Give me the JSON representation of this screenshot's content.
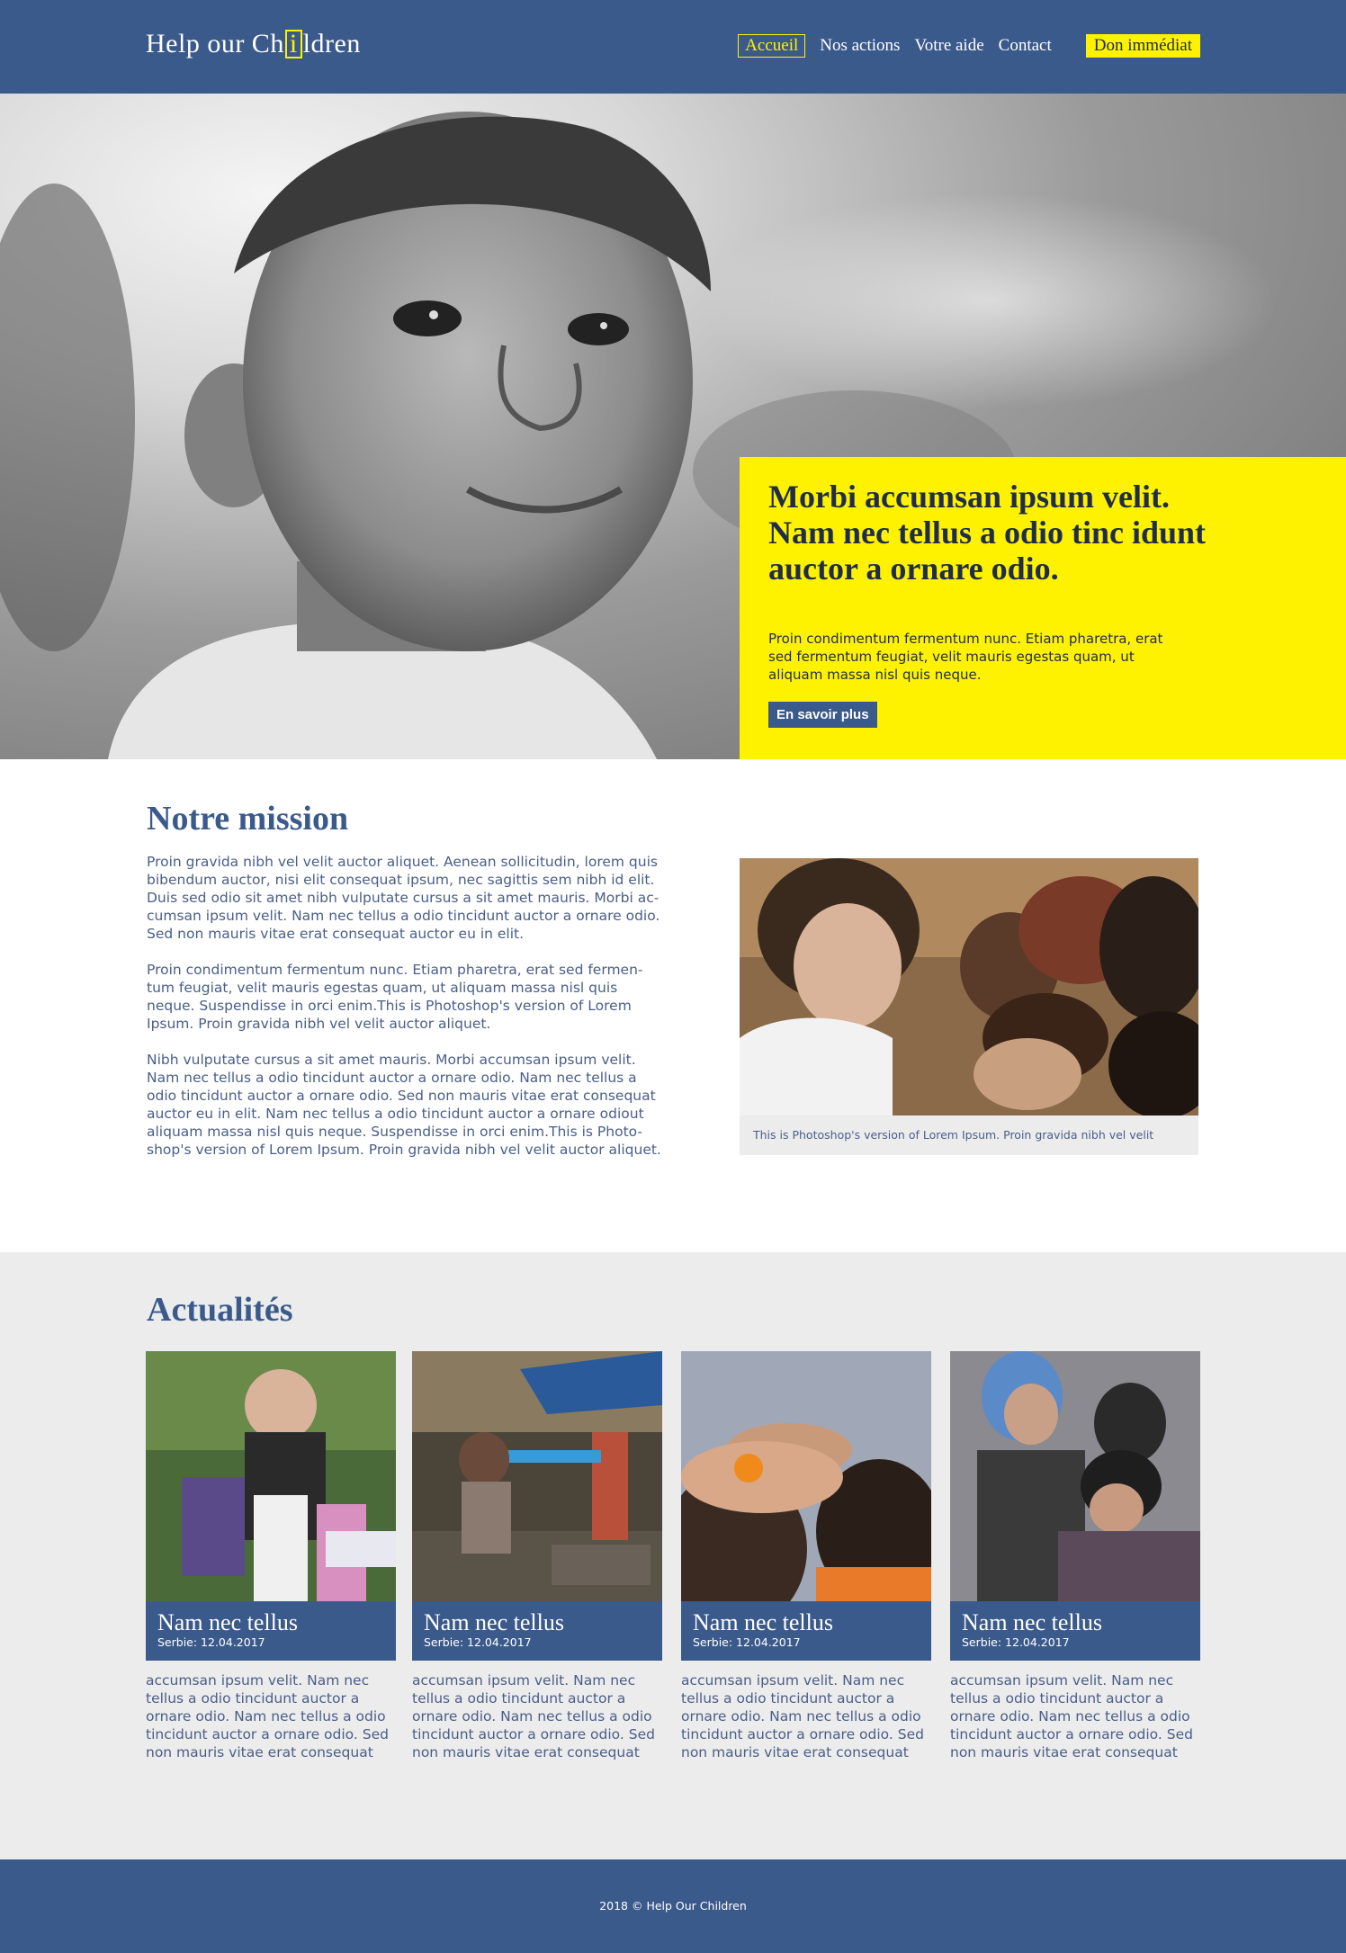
{
  "header": {
    "logo_before": "Help our Ch",
    "logo_i": "i",
    "logo_after": "ldren",
    "nav": {
      "home": "Accueil",
      "actions": "Nos actions",
      "help": "Votre aide",
      "contact": "Contact",
      "donate": "Don immédiat"
    }
  },
  "hero": {
    "title": "Morbi accumsan ipsum velit. Nam nec tellus a odio tinc idunt auctor a ornare odio.",
    "text": "Proin condimentum fermentum nunc. Etiam pharetra, erat sed fermentum feugiat, velit mauris egestas quam, ut aliquam massa nisl quis neque.",
    "button": "En savoir plus"
  },
  "mission": {
    "title": "Notre mission",
    "paragraphs": [
      "Proin gravida nibh vel velit auctor aliquet. Aenean sollicitudin, lorem quis bibendum auctor, nisi elit consequat ipsum, nec sagittis sem nibh id elit. Duis sed odio sit amet nibh vulputate cursus a sit amet mauris. Morbi ac-cumsan ipsum velit. Nam nec tellus a odio tincidunt auctor a ornare odio. Sed non  mauris vitae erat consequat auctor eu in elit.",
      "Proin condimentum fermentum nunc. Etiam pharetra, erat sed fermen-tum feugiat, velit mauris egestas quam, ut aliquam massa nisl quis neque. Suspendisse in orci enim.This is Photoshop's version  of Lorem Ipsum. Proin gravida nibh vel velit auctor aliquet.",
      "Nibh vulputate cursus a sit amet mauris. Morbi accumsan ipsum velit. Nam nec tellus a odio tincidunt auctor a ornare odio. Nam nec tellus a odio tincidunt auctor a ornare odio. Sed non  mauris vitae erat consequat auctor eu in elit. Nam nec tellus a odio tincidunt auctor a ornare odiout aliquam massa nisl quis neque. Suspendisse in orci enim.This is Photo-shop's version  of Lorem Ipsum. Proin gravida nibh vel velit auctor aliquet."
    ],
    "caption": "This is Photoshop's version  of Lorem Ipsum. Proin gravida nibh vel velit"
  },
  "news": {
    "title": "Actualités",
    "cards": [
      {
        "title": "Nam nec tellus",
        "meta": "Serbie: 12.04.2017",
        "text": "accumsan ipsum velit. Nam nec tellus a odio tincidunt auctor a ornare odio. Nam nec tellus a odio tincidunt auctor a ornare odio. Sed non  mauris vitae erat consequat"
      },
      {
        "title": "Nam nec tellus",
        "meta": "Serbie: 12.04.2017",
        "text": "accumsan ipsum velit. Nam nec tellus a odio tincidunt auctor a ornare odio. Nam nec tellus a odio tincidunt auctor a ornare odio. Sed non  mauris vitae erat consequat"
      },
      {
        "title": "Nam nec tellus",
        "meta": "Serbie: 12.04.2017",
        "text": "accumsan ipsum velit. Nam nec tellus a odio tincidunt auctor a ornare odio. Nam nec tellus a odio tincidunt auctor a ornare odio. Sed non  mauris vitae erat consequat"
      },
      {
        "title": "Nam nec tellus",
        "meta": "Serbie: 12.04.2017",
        "text": "accumsan ipsum velit. Nam nec tellus a odio tincidunt auctor a ornare odio. Nam nec tellus a odio tincidunt auctor a ornare odio. Sed non  mauris vitae erat consequat"
      }
    ]
  },
  "footer": {
    "text": "2018 © Help Our Children"
  },
  "colors": {
    "brand_blue": "#3b5a8c",
    "accent_yellow": "#fff200",
    "light_gray": "#ececec"
  }
}
